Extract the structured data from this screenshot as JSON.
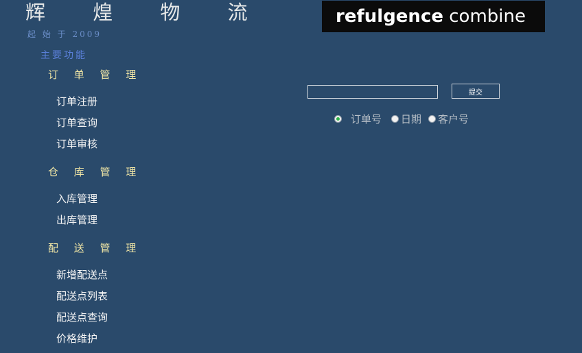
{
  "header": {
    "title": "辉 煌 物 流",
    "subtitle": "起 始 于 2009",
    "logo_bold": "refulgence",
    "logo_light": "combine"
  },
  "sidebar": {
    "heading": "主要功能",
    "sections": [
      {
        "title": "订 单 管 理",
        "links": [
          "订单注册",
          "订单查询",
          "订单审核"
        ]
      },
      {
        "title": "仓 库 管 理",
        "links": [
          "入库管理",
          "出库管理"
        ]
      },
      {
        "title": "配 送 管 理",
        "links": [
          "新增配送点",
          "配送点列表",
          "配送点查询",
          "价格维护"
        ]
      }
    ]
  },
  "search": {
    "value": "",
    "submit_label": "提交",
    "options": [
      {
        "label": "订单号",
        "checked": true
      },
      {
        "label": "日期",
        "checked": false
      },
      {
        "label": "客户号",
        "checked": false
      }
    ]
  }
}
